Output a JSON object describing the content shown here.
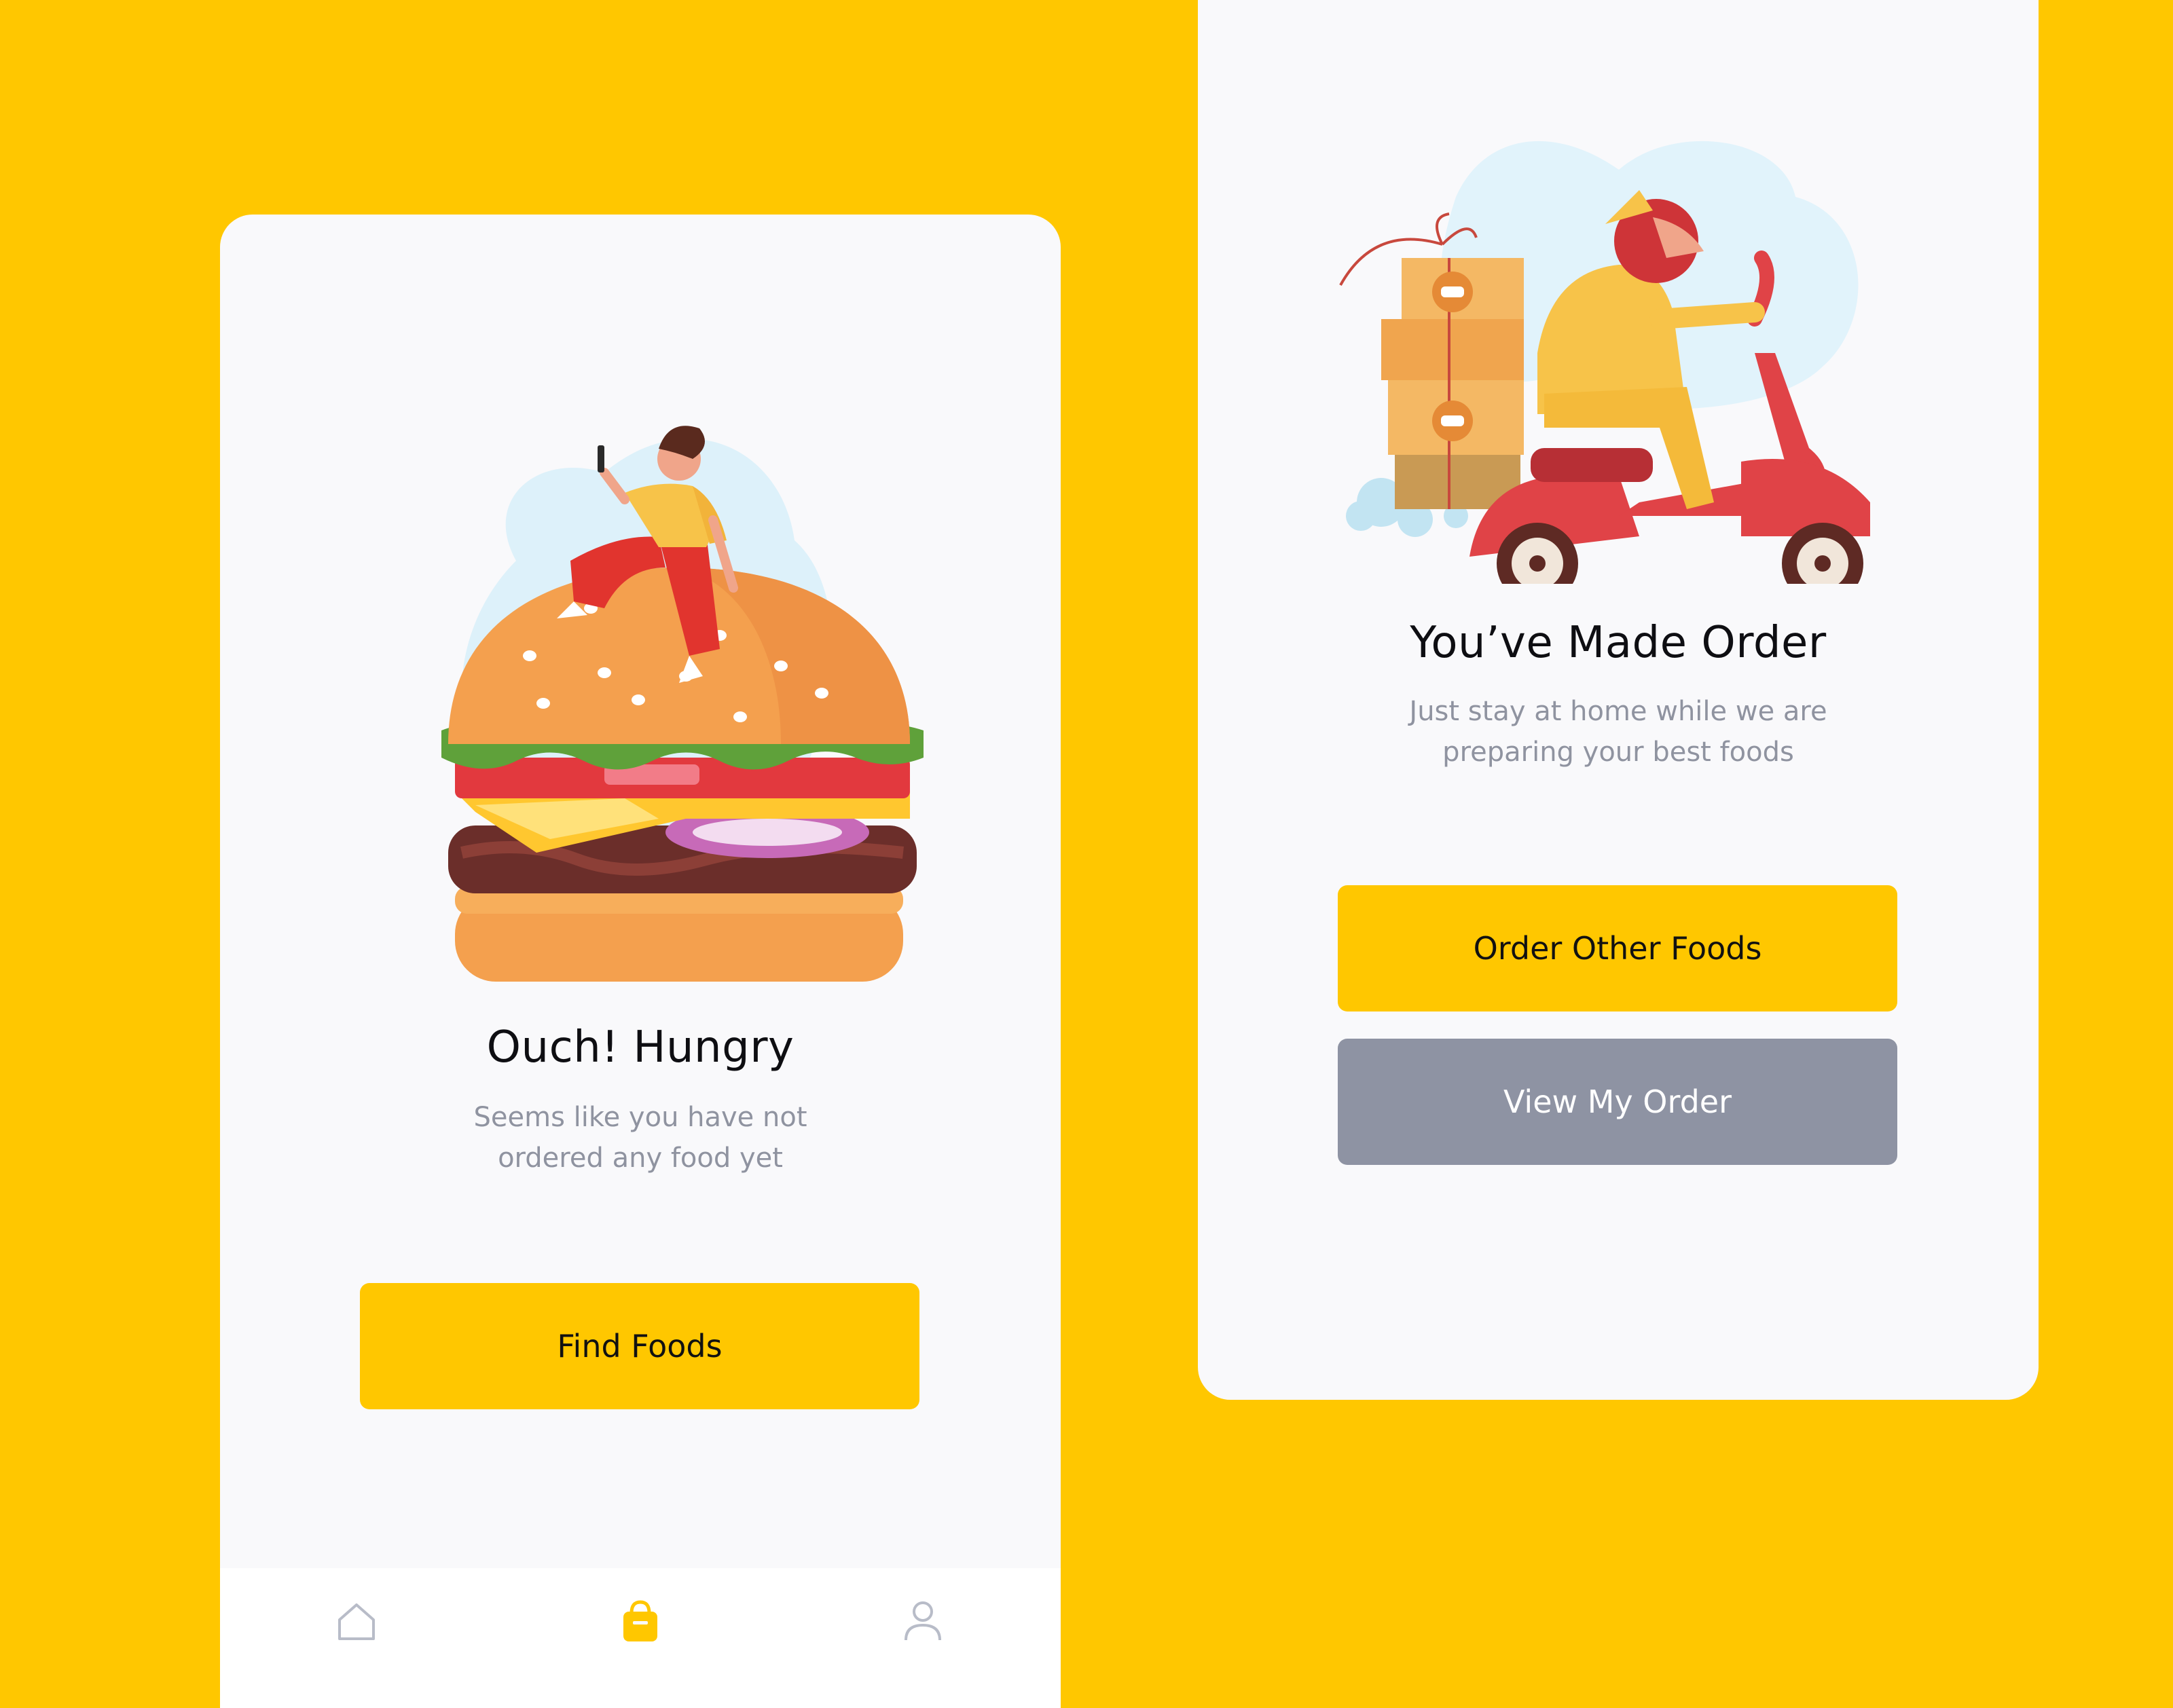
{
  "screens": {
    "empty": {
      "title": "Ouch! Hungry",
      "subtitle_lines": [
        "Seems like you have not",
        "ordered any food yet"
      ],
      "primary_button": "Find Foods",
      "tabbar": {
        "tabs": [
          {
            "icon": "home-icon",
            "active": false
          },
          {
            "icon": "shopping-bag-icon",
            "active": true
          },
          {
            "icon": "profile-icon",
            "active": false
          }
        ]
      }
    },
    "ordered": {
      "title": "You’ve Made Order",
      "subtitle_lines": [
        "Just stay at home while we are",
        "preparing your best foods"
      ],
      "primary_button": "Order Other Foods",
      "secondary_button": "View My Order"
    }
  },
  "colors": {
    "background": "#FFC700",
    "card": "#F9F9FB",
    "primary": "#FFC700",
    "secondary": "#8E93A3",
    "title": "#0E0E12",
    "subtitle": "#8F93A0"
  }
}
